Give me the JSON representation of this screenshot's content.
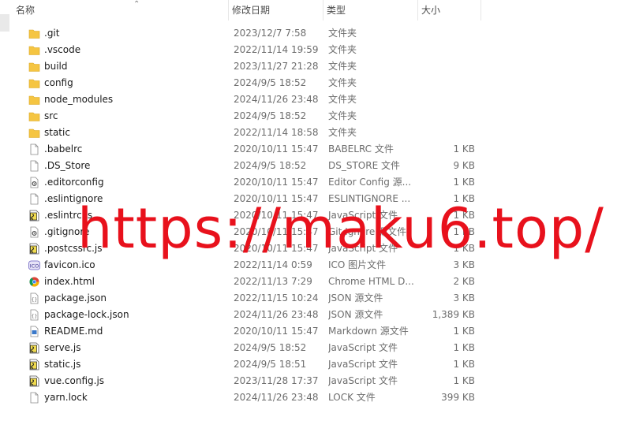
{
  "columns": {
    "name": "名称",
    "date": "修改日期",
    "type": "类型",
    "size": "大小"
  },
  "watermark": "https://maku6.top/",
  "files": [
    {
      "name": ".git",
      "date": "2023/12/7 7:58",
      "type": "文件夹",
      "size": "",
      "icon": "folder-icon"
    },
    {
      "name": ".vscode",
      "date": "2022/11/14 19:59",
      "type": "文件夹",
      "size": "",
      "icon": "folder-icon"
    },
    {
      "name": "build",
      "date": "2023/11/27 21:28",
      "type": "文件夹",
      "size": "",
      "icon": "folder-icon"
    },
    {
      "name": "config",
      "date": "2024/9/5 18:52",
      "type": "文件夹",
      "size": "",
      "icon": "folder-icon"
    },
    {
      "name": "node_modules",
      "date": "2024/11/26 23:48",
      "type": "文件夹",
      "size": "",
      "icon": "folder-icon"
    },
    {
      "name": "src",
      "date": "2024/9/5 18:52",
      "type": "文件夹",
      "size": "",
      "icon": "folder-icon"
    },
    {
      "name": "static",
      "date": "2022/11/14 18:58",
      "type": "文件夹",
      "size": "",
      "icon": "folder-icon"
    },
    {
      "name": ".babelrc",
      "date": "2020/10/11 15:47",
      "type": "BABELRC 文件",
      "size": "1 KB",
      "icon": "blank-file-icon"
    },
    {
      "name": ".DS_Store",
      "date": "2024/9/5 18:52",
      "type": "DS_STORE 文件",
      "size": "9 KB",
      "icon": "blank-file-icon"
    },
    {
      "name": ".editorconfig",
      "date": "2020/10/11 15:47",
      "type": "Editor Config 源...",
      "size": "1 KB",
      "icon": "config-file-icon"
    },
    {
      "name": ".eslintignore",
      "date": "2020/10/11 15:47",
      "type": "ESLINTIGNORE ...",
      "size": "1 KB",
      "icon": "blank-file-icon"
    },
    {
      "name": ".eslintrc.js",
      "date": "2020/10/11 15:47",
      "type": "JavaScript 文件",
      "size": "1 KB",
      "icon": "js-file-icon"
    },
    {
      "name": ".gitignore",
      "date": "2020/10/11 15:47",
      "type": "Git Ignore 源文件",
      "size": "1 KB",
      "icon": "config-file-icon"
    },
    {
      "name": ".postcssrc.js",
      "date": "2020/10/11 15:47",
      "type": "JavaScript 文件",
      "size": "1 KB",
      "icon": "js-file-icon"
    },
    {
      "name": "favicon.ico",
      "date": "2022/11/14 0:59",
      "type": "ICO 图片文件",
      "size": "3 KB",
      "icon": "ico-file-icon"
    },
    {
      "name": "index.html",
      "date": "2022/11/13 7:29",
      "type": "Chrome HTML D...",
      "size": "2 KB",
      "icon": "chrome-html-icon"
    },
    {
      "name": "package.json",
      "date": "2022/11/15 10:24",
      "type": "JSON 源文件",
      "size": "3 KB",
      "icon": "json-file-icon"
    },
    {
      "name": "package-lock.json",
      "date": "2024/11/26 23:48",
      "type": "JSON 源文件",
      "size": "1,389 KB",
      "icon": "json-file-icon"
    },
    {
      "name": "README.md",
      "date": "2020/10/11 15:47",
      "type": "Markdown 源文件",
      "size": "1 KB",
      "icon": "markdown-file-icon"
    },
    {
      "name": "serve.js",
      "date": "2024/9/5 18:52",
      "type": "JavaScript 文件",
      "size": "1 KB",
      "icon": "js-file-icon"
    },
    {
      "name": "static.js",
      "date": "2024/9/5 18:51",
      "type": "JavaScript 文件",
      "size": "1 KB",
      "icon": "js-file-icon"
    },
    {
      "name": "vue.config.js",
      "date": "2023/11/28 17:37",
      "type": "JavaScript 文件",
      "size": "1 KB",
      "icon": "js-file-icon"
    },
    {
      "name": "yarn.lock",
      "date": "2024/11/26 23:48",
      "type": "LOCK 文件",
      "size": "399 KB",
      "icon": "blank-file-icon"
    }
  ],
  "colors": {
    "folder": "#f5c542",
    "js_badge": "#f0db4f",
    "watermark": "#e8111c"
  }
}
